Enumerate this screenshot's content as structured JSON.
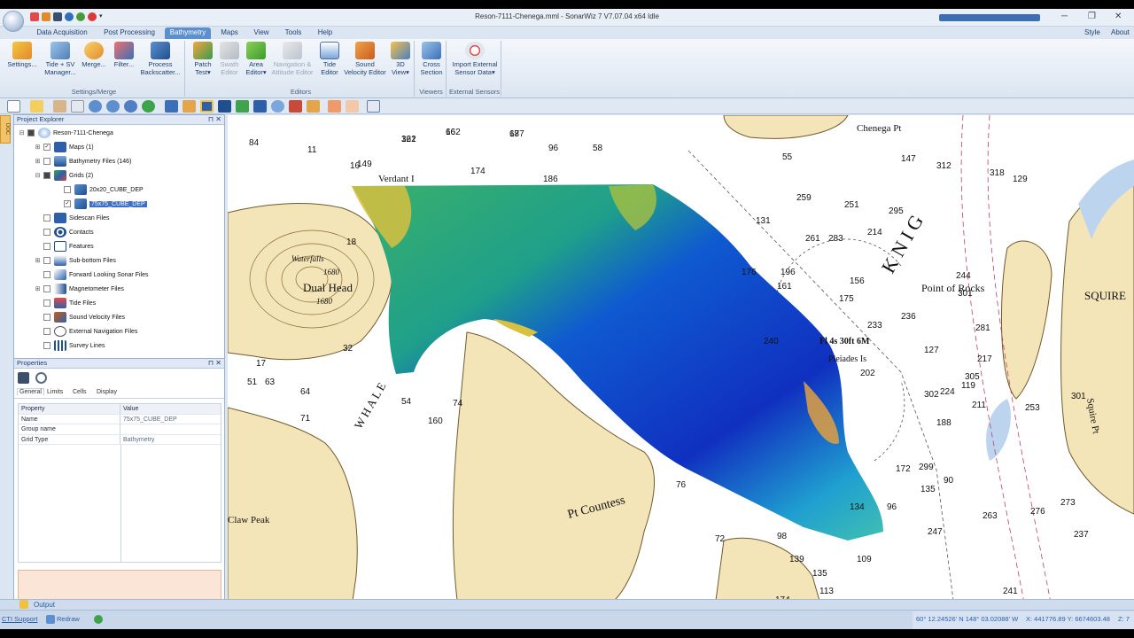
{
  "window": {
    "title": "Reson-7111-Chenega.mml - SonarWiz 7 V7.07.04 x64  Idle"
  },
  "tabs": [
    "Data Acquisition",
    "Post Processing",
    "Bathymetry",
    "Maps",
    "View",
    "Tools",
    "Help"
  ],
  "active_tab": "Bathymetry",
  "tabs_right": {
    "style": "Style",
    "about": "About"
  },
  "ribbon": {
    "settings_merge": {
      "label": "Settings/Merge",
      "settings": "Settings...",
      "tide_sv_1": "Tide + SV",
      "tide_sv_2": "Manager...",
      "merge": "Merge...",
      "filter": "Filter...",
      "process_1": "Process",
      "process_2": "Backscatter..."
    },
    "editors": {
      "label": "Editors",
      "patch_1": "Patch",
      "patch_2": "Test",
      "swath_1": "Swath",
      "swath_2": "Editor",
      "area_1": "Area",
      "area_2": "Editor",
      "nav_1": "Navigation &",
      "nav_2": "Attitude Editor",
      "tide_1": "Tide",
      "tide_2": "Editor",
      "sv_1": "Sound",
      "sv_2": "Velocity Editor",
      "view3d_1": "3D",
      "view3d_2": "View"
    },
    "viewers": {
      "label": "Viewers",
      "cross_1": "Cross",
      "cross_2": "Section"
    },
    "external": {
      "label": "External Sensors",
      "import_1": "Import External",
      "import_2": "Sensor Data"
    }
  },
  "project_explorer": {
    "title": "Project Explorer",
    "root": "Reson-7111-Chenega",
    "items": [
      {
        "label": "Maps (1)"
      },
      {
        "label": "Bathymetry Files (146)"
      },
      {
        "label": "Grids (2)"
      },
      {
        "label": "20x20_CUBE_DEP"
      },
      {
        "label": "75x75_CUBE_DEP"
      },
      {
        "label": "Sidescan Files"
      },
      {
        "label": "Contacts"
      },
      {
        "label": "Features"
      },
      {
        "label": "Sub-bottom Files"
      },
      {
        "label": "Forward Looking Sonar Files"
      },
      {
        "label": "Magnetometer Files"
      },
      {
        "label": "Tide Files"
      },
      {
        "label": "Sound Velocity Files"
      },
      {
        "label": "External Navigation Files"
      },
      {
        "label": "Survey Lines"
      }
    ]
  },
  "properties": {
    "title": "Properties",
    "tabs": [
      "General",
      "Limits",
      "Cells",
      "Display"
    ],
    "header": {
      "property": "Property",
      "value": "Value"
    },
    "rows": [
      {
        "property": "Name",
        "value": "75x75_CUBE_DEP"
      },
      {
        "property": "Group name",
        "value": ""
      },
      {
        "property": "Grid Type",
        "value": "Bathymetry"
      }
    ]
  },
  "map": {
    "labels": {
      "verdant": "Verdant I",
      "dual_head": "Dual Head",
      "waterfalls": "Waterfalls",
      "whale": "W H A L E",
      "pt_countess": "Pt Countess",
      "claw_peak": "Claw Peak",
      "point_of_rocks": "Point of Rocks",
      "squire": "SQUIRE",
      "squire_pt": "Squire Pt",
      "pleiades": "Pleiades Is",
      "light": "Fl 4s 30ft 6M",
      "chenega_pt": "Chenega Pt",
      "knig": "K N I G",
      "elev_1680a": "1680",
      "elev_1680b": "1680"
    },
    "soundings": [
      "162",
      "177",
      "161",
      "174",
      "186",
      "149",
      "11",
      "84",
      "96",
      "58",
      "55",
      "147",
      "295",
      "312",
      "318",
      "129",
      "259",
      "251",
      "283",
      "214",
      "261",
      "176",
      "161",
      "175",
      "156",
      "233",
      "236",
      "281",
      "305",
      "217",
      "302",
      "224",
      "211",
      "253",
      "301",
      "299",
      "172",
      "135",
      "90",
      "276",
      "273",
      "263",
      "247",
      "237",
      "241",
      "16",
      "18",
      "32",
      "17",
      "51",
      "63",
      "64",
      "71",
      "74",
      "54",
      "160",
      "76",
      "72",
      "109",
      "135",
      "113",
      "174",
      "139",
      "134",
      "96",
      "98",
      "119",
      "188",
      "301",
      "244",
      "131",
      "196",
      "240",
      "202",
      "127",
      "66",
      "68",
      "322"
    ]
  },
  "output_tab": "Output",
  "status": {
    "cti_support": "CTI Support",
    "redraw": "Redraw",
    "coords": "60° 12.24526' N  148° 03.02088' W",
    "xy": "X: 441776.89 Y: 6674603.48",
    "zoom": "Z: 7"
  },
  "colors": {
    "ribbon_active": "#5b8fd0",
    "land": "#f4e5b8",
    "selection": "#3d6fc2"
  }
}
